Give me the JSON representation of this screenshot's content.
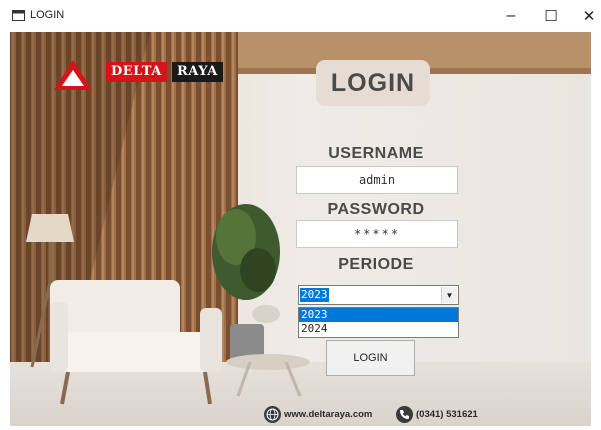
{
  "window": {
    "title": "LOGIN",
    "icon": "window-app-icon",
    "controls": {
      "minimize": "–",
      "maximize": "☐",
      "close": "✕"
    }
  },
  "brand": {
    "name_red": "DELTA",
    "name_black": "RAYA",
    "colors": {
      "red": "#d7131a",
      "black": "#1a1a1a"
    }
  },
  "form": {
    "heading": "LOGIN",
    "username_label": "USERNAME",
    "username_value": "admin",
    "password_label": "PASSWORD",
    "password_value": "*****",
    "periode_label": "PERIODE",
    "periode_selected": "2023",
    "periode_options": [
      "2023",
      "2024"
    ],
    "submit_label": "LOGIN"
  },
  "footer": {
    "website": "www.deltaraya.com",
    "phone": "(0341) 531621",
    "website_icon": "globe-icon",
    "phone_icon": "phone-icon"
  },
  "colors": {
    "selection": "#0078d7",
    "heading_bg": "#e6dcd3",
    "text": "#4a4a4a"
  }
}
